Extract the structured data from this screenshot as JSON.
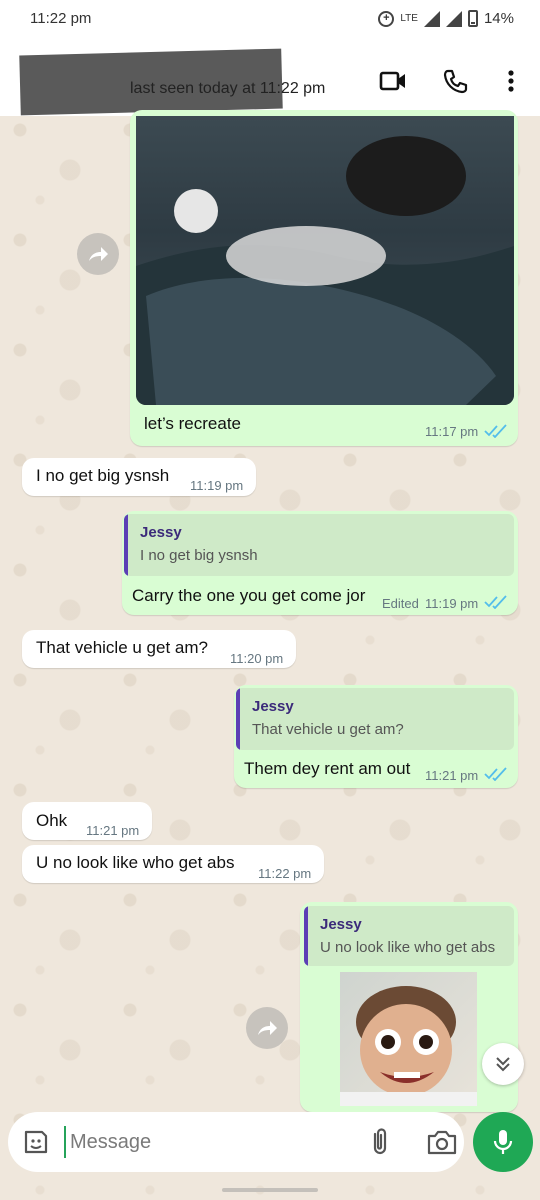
{
  "status_bar": {
    "time": "11:22 pm",
    "network": "LTE",
    "battery": "14%"
  },
  "header": {
    "last_seen": "last seen today at 11:22 pm"
  },
  "messages": [
    {
      "text": "let’s recreate",
      "time": "11:17 pm"
    },
    {
      "text": "I no get big ysnsh",
      "time": "11:19 pm"
    },
    {
      "quote_name": "Jessy",
      "quote_text": "I no get big ysnsh",
      "text": "Carry the one you get come jor",
      "edited": "Edited",
      "time": "11:19 pm"
    },
    {
      "text": "That vehicle u get am?",
      "time": "11:20 pm"
    },
    {
      "quote_name": "Jessy",
      "quote_text": "That vehicle u get am?",
      "text": "Them dey rent am out",
      "time": "11:21 pm"
    },
    {
      "text": "Ohk",
      "time": "11:21 pm"
    },
    {
      "text": "U no look like who get abs",
      "time": "11:22 pm"
    },
    {
      "quote_name": "Jessy",
      "quote_text": "U no look like who get abs"
    }
  ],
  "input": {
    "placeholder": "Message"
  },
  "colors": {
    "outgoing": "#d9fdd3",
    "incoming": "#ffffff",
    "accent": "#1fa855",
    "tick_read": "#53bdeb",
    "quote_bar": "#5b3fb5"
  },
  "icons": [
    "video-call-icon",
    "voice-call-icon",
    "more-options-icon",
    "forward-icon",
    "double-check-icon",
    "chevron-down-icon",
    "sticker-icon",
    "attach-icon",
    "camera-icon",
    "mic-icon"
  ]
}
